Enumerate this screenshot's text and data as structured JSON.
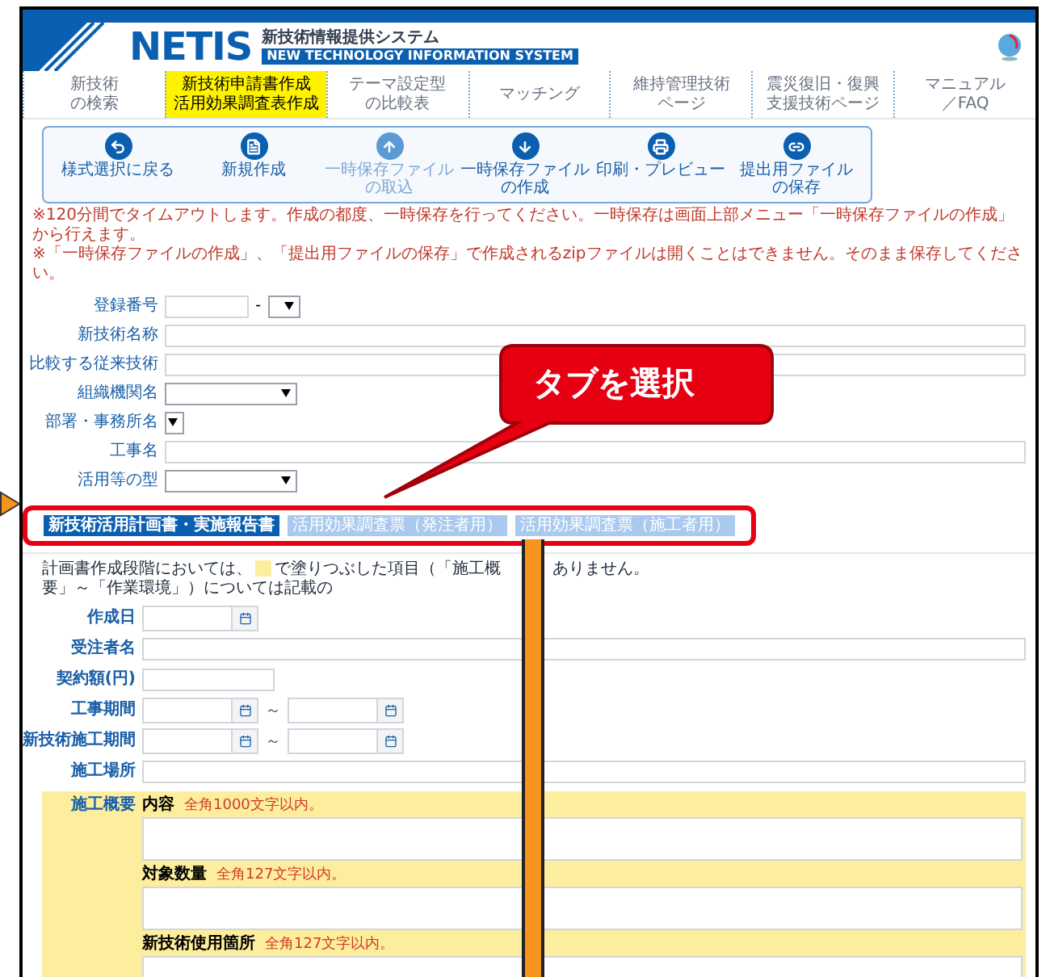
{
  "header": {
    "logo": "NETIS",
    "subtitle": "新技術情報提供システム",
    "english": "NEW TECHNOLOGY INFORMATION SYSTEM"
  },
  "nav": [
    {
      "lines": [
        "新技術",
        "の検索"
      ],
      "selected": false
    },
    {
      "lines": [
        "新技術申請書作成",
        "活用効果調査表作成"
      ],
      "selected": true
    },
    {
      "lines": [
        "テーマ設定型",
        "の比較表"
      ],
      "selected": false
    },
    {
      "lines": [
        "マッチング"
      ],
      "selected": false
    },
    {
      "lines": [
        "維持管理技術",
        "ページ"
      ],
      "selected": false
    },
    {
      "lines": [
        "震災復旧・復興",
        "支援技術ページ"
      ],
      "selected": false
    },
    {
      "lines": [
        "マニュアル",
        "／FAQ"
      ],
      "selected": false
    }
  ],
  "toolbar": [
    {
      "lines": [
        "様式選択に戻る"
      ],
      "disabled": false
    },
    {
      "lines": [
        "新規作成"
      ],
      "disabled": false
    },
    {
      "lines": [
        "一時保存ファイル",
        "の取込"
      ],
      "disabled": true
    },
    {
      "lines": [
        "一時保存ファイル",
        "の作成"
      ],
      "disabled": false
    },
    {
      "lines": [
        "印刷・プレビュー"
      ],
      "disabled": false
    },
    {
      "lines": [
        "提出用ファイル",
        "の保存"
      ],
      "disabled": false
    }
  ],
  "notes": [
    "※120分間でタイムアウトします。作成の都度、一時保存を行ってください。一時保存は画面上部メニュー「一時保存ファイルの作成」から行えます。",
    "※「一時保存ファイルの作成」、「提出用ファイルの保存」で作成されるzipファイルは開くことはできません。そのまま保存してください。"
  ],
  "form": [
    {
      "label": "登録番号",
      "kind": "number",
      "separator": "-"
    },
    {
      "label": "新技術名称",
      "kind": "text"
    },
    {
      "label": "比較する従来技術",
      "kind": "text"
    },
    {
      "label": "組織機関名",
      "kind": "select"
    },
    {
      "label": "部署・事務所名",
      "kind": "tiny"
    },
    {
      "label": "工事名",
      "kind": "text"
    },
    {
      "label": "活用等の型",
      "kind": "select"
    }
  ],
  "tabs": [
    {
      "label": "新技術活用計画書・実施報告書",
      "selected": true
    },
    {
      "label": "活用効果調査票（発注者用）",
      "selected": false
    },
    {
      "label": "活用効果調査票（施工者用）",
      "selected": false
    }
  ],
  "instruction": {
    "before": "計画書作成段階においては、",
    "after": "で塗りつぶした項目（「施工概要」～「作業環境」）については記載の",
    "tail": "ありません。"
  },
  "details": [
    {
      "label": "作成日",
      "kind": "date"
    },
    {
      "label": "受注者名",
      "kind": "text"
    },
    {
      "label": "契約額(円)",
      "kind": "short"
    },
    {
      "label": "工事期間",
      "kind": "range",
      "separator": "～"
    },
    {
      "label": "新技術施工期間",
      "kind": "range",
      "separator": "～"
    },
    {
      "label": "施工場所",
      "kind": "text"
    }
  ],
  "overview": {
    "label": "施工概要",
    "fields": [
      {
        "label": "内容",
        "limit": "全角1000文字以内。"
      },
      {
        "label": "対象数量",
        "limit": "全角127文字以内。"
      },
      {
        "label": "新技術使用箇所",
        "limit": "全角127文字以内。"
      }
    ]
  },
  "callout": "タブを選択"
}
